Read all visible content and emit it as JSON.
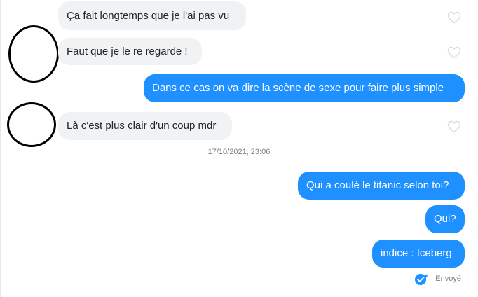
{
  "messages": {
    "m1": "Ça fait longtemps que je l'ai pas vu",
    "m2": "Faut que je le re regarde !",
    "m3": "Dans ce cas on va dire la scène de sexe pour faire plus simple",
    "m4": "Là c'est plus clair d'un coup mdr",
    "m5": "Qui a coulé le titanic selon toi?",
    "m6": "Qui?",
    "m7": "indice : Iceberg"
  },
  "timestamp": "17/10/2021, 23:06",
  "status": {
    "label": "Envoyé",
    "icon": "double-check-icon"
  },
  "colors": {
    "incoming_bg": "#f0f2f4",
    "outgoing_bg": "#1e90ff",
    "meta_text": "#7a8088",
    "heart_outline": "#d9dde2",
    "redaction_circle": "#000000"
  }
}
